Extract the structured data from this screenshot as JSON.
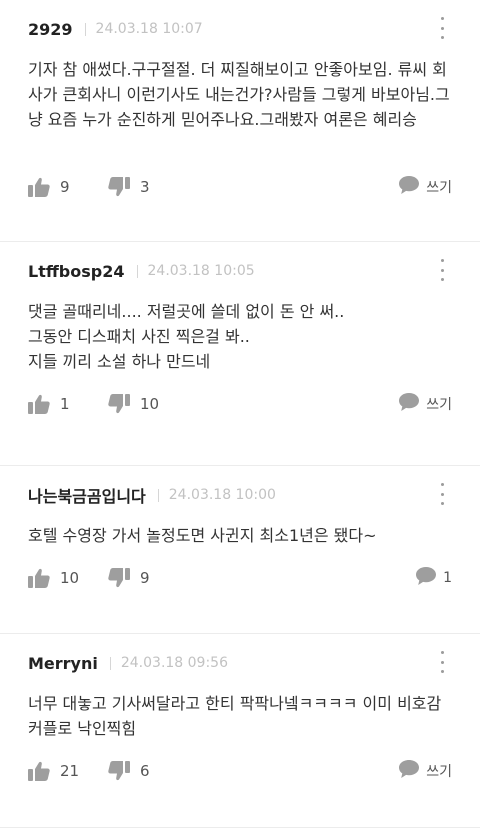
{
  "comments": [
    {
      "author": "2929",
      "date": "24.03.18 10:07",
      "text": "기자 참 애썼다.구구절절. 더 찌질해보이고 안좋아보임. 류씨 회사가 큰회사니 이런기사도 내는건가?사람들 그렇게 바보아님.그냥 요즘 누가 순진하게 믿어주나요.그래봤자 여론은 혜리승",
      "likes": "9",
      "dislikes": "3",
      "reply": "쓰기"
    },
    {
      "author": "Ltffbosp24",
      "date": "24.03.18 10:05",
      "text": "댓글 골때리네....  저럴곳에 쓸데 없이 돈 안 써..\n그동안 디스패치 사진 찍은걸 봐..\n지들 끼리 소설 하나 만드네",
      "likes": "1",
      "dislikes": "10",
      "reply": "쓰기"
    },
    {
      "author": "나는북금곰입니다",
      "date": "24.03.18 10:00",
      "text": "호텔 수영장 가서 놀정도면 사귄지 최소1년은 됐다~",
      "likes": "10",
      "dislikes": "9",
      "reply": "1"
    },
    {
      "author": "Merryni",
      "date": "24.03.18 09:56",
      "text": "너무 대놓고 기사써달라고 한티 팍팍나넼ㅋㅋㅋㅋ 이미 비호감 커플로 낙인찍힘",
      "likes": "21",
      "dislikes": "6",
      "reply": "쓰기"
    }
  ],
  "colors": {
    "icon": "#9e9e9e",
    "date": "#c2c2c2",
    "divider": "#ececec"
  },
  "icons": {
    "like": "thumbs-up-icon",
    "dislike": "thumbs-down-icon",
    "reply": "speech-bubble-icon",
    "more": "vertical-dots-icon"
  }
}
